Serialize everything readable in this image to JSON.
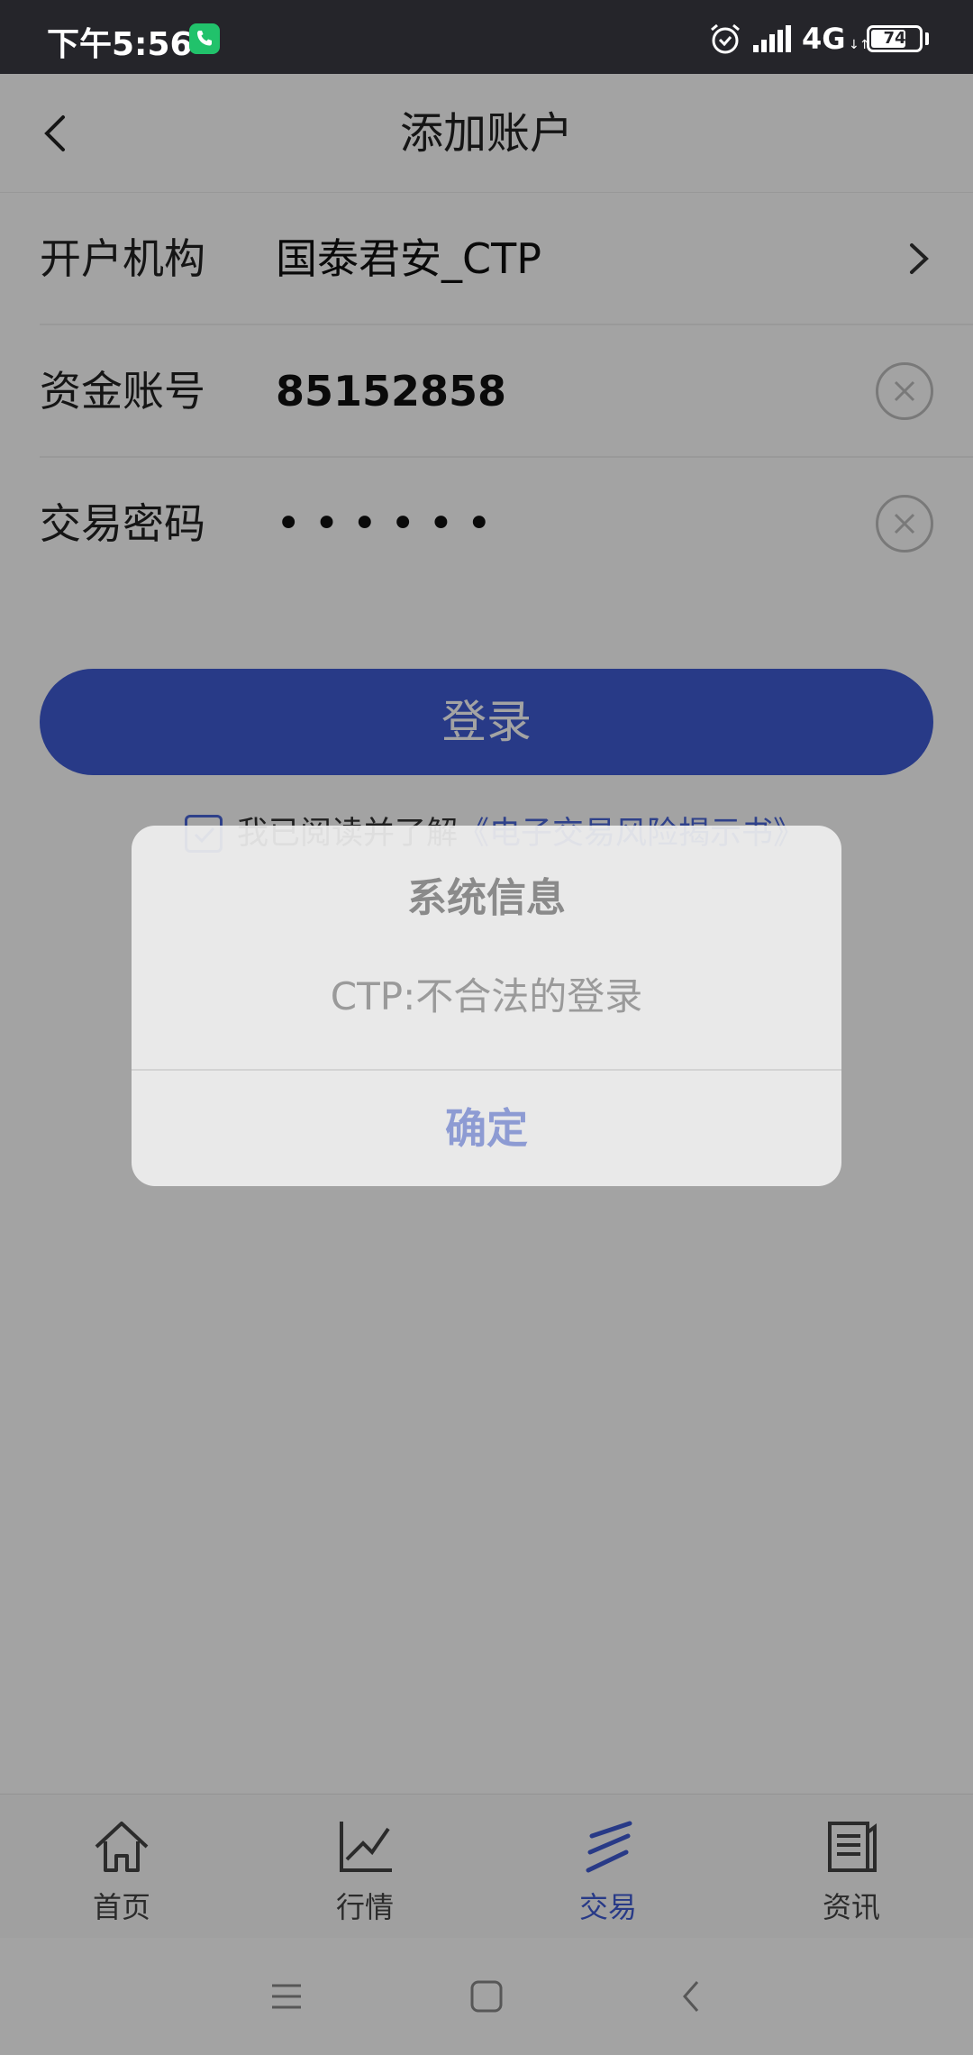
{
  "status_bar": {
    "time": "下午5:56",
    "network": "4G",
    "net_arrows": "↓↑",
    "battery": "74",
    "battery_level": 0.74,
    "icons": [
      "call-icon",
      "alarm-icon",
      "signal-icon",
      "battery-icon"
    ]
  },
  "header": {
    "title": "添加账户",
    "back_icon": "chevron-left-icon"
  },
  "form": {
    "institution": {
      "label": "开户机构",
      "value": "国泰君安_CTP"
    },
    "account": {
      "label": "资金账号",
      "value": "85152858"
    },
    "password": {
      "label": "交易密码",
      "value": "••••••"
    }
  },
  "login": {
    "label": "登录"
  },
  "agreement": {
    "checked": true,
    "text": "我已阅读并了解",
    "link": "《电子交易风险揭示书》"
  },
  "dialog": {
    "title": "系统信息",
    "message": "CTP:不合法的登录",
    "confirm": "确定"
  },
  "tabs": [
    {
      "label": "首页",
      "icon": "home-icon",
      "active": false
    },
    {
      "label": "行情",
      "icon": "chart-icon",
      "active": false
    },
    {
      "label": "交易",
      "icon": "trade-icon",
      "active": true
    },
    {
      "label": "资讯",
      "icon": "news-icon",
      "active": false
    }
  ],
  "colors": {
    "accent": "#3f5bd4",
    "status_bar": "#25252a",
    "call_green": "#21c26b"
  }
}
